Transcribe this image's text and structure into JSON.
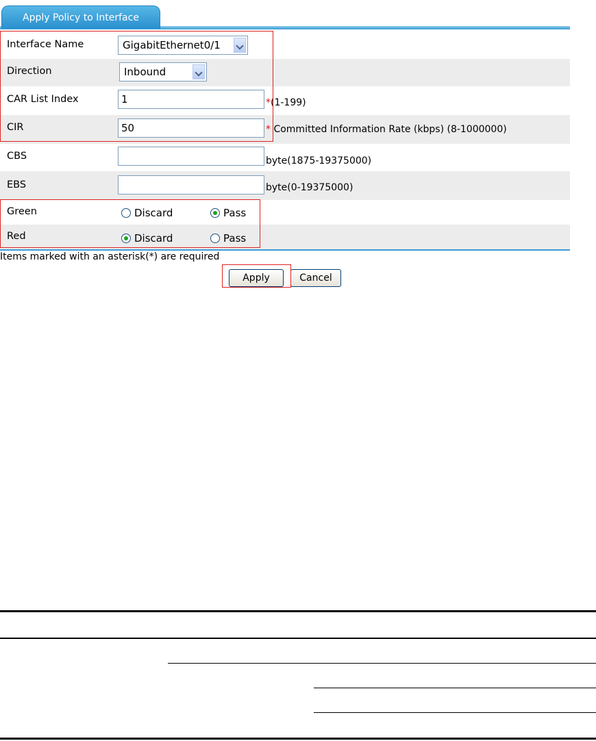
{
  "tab": {
    "label": "Apply Policy to Interface"
  },
  "form": {
    "interface_name": {
      "label": "Interface Name",
      "value": "GigabitEthernet0/1"
    },
    "direction": {
      "label": "Direction",
      "value": "Inbound"
    },
    "car_list_index": {
      "label": "CAR List Index",
      "value": "1",
      "hint": "(1-199)",
      "required": "*"
    },
    "cir": {
      "label": "CIR",
      "value": "50",
      "hint": " Committed Information Rate (kbps) (8-1000000)",
      "required": "*"
    },
    "cbs": {
      "label": "CBS",
      "value": "",
      "hint": "byte(1875-19375000)"
    },
    "ebs": {
      "label": "EBS",
      "value": "",
      "hint": "byte(0-19375000)"
    },
    "green": {
      "label": "Green",
      "option_discard": "Discard",
      "option_pass": "Pass",
      "selected": "Pass"
    },
    "red": {
      "label": "Red",
      "option_discard": "Discard",
      "option_pass": "Pass",
      "selected": "Discard"
    }
  },
  "note": "Items marked with an asterisk(*) are required",
  "buttons": {
    "apply": "Apply",
    "cancel": "Cancel"
  },
  "colors": {
    "tab": "#2a8fcf",
    "alt_row": "#ececec",
    "highlight": "#e02020",
    "radio_dot": "#21a121"
  }
}
